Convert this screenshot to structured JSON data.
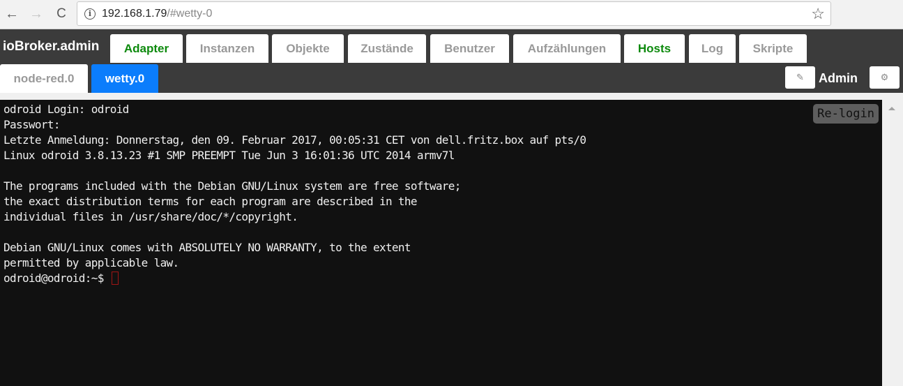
{
  "browser": {
    "url_host": "192.168.1.79",
    "url_path": "/#wetty-0",
    "back_icon": "←",
    "forward_icon": "→",
    "reload_icon": "C",
    "info_icon": "i",
    "star_icon": "☆"
  },
  "header": {
    "brand": "ioBroker.admin",
    "tabs": [
      {
        "label": "Adapter",
        "color": "#0d8a0d"
      },
      {
        "label": "Instanzen"
      },
      {
        "label": "Objekte"
      },
      {
        "label": "Zustände"
      },
      {
        "label": "Benutzer"
      },
      {
        "label": "Aufzählungen"
      },
      {
        "label": "Hosts",
        "color": "#0d8a0d"
      },
      {
        "label": "Log"
      },
      {
        "label": "Skripte"
      }
    ],
    "sub_tabs": [
      {
        "label": "node-red.0",
        "active": false
      },
      {
        "label": "wetty.0",
        "active": true
      }
    ],
    "edit_icon": "✎",
    "user": "Admin",
    "settings_icon": "⚙"
  },
  "terminal": {
    "relogin_label": "Re-login",
    "lines": [
      "odroid Login: odroid",
      "Passwort:",
      "Letzte Anmeldung: Donnerstag, den 09. Februar 2017, 00:05:31 CET von dell.fritz.box auf pts/0",
      "Linux odroid 3.8.13.23 #1 SMP PREEMPT Tue Jun 3 16:01:36 UTC 2014 armv7l",
      "",
      "The programs included with the Debian GNU/Linux system are free software;",
      "the exact distribution terms for each program are described in the",
      "individual files in /usr/share/doc/*/copyright.",
      "",
      "Debian GNU/Linux comes with ABSOLUTELY NO WARRANTY, to the extent",
      "permitted by applicable law."
    ],
    "prompt": "odroid@odroid:~$ "
  }
}
